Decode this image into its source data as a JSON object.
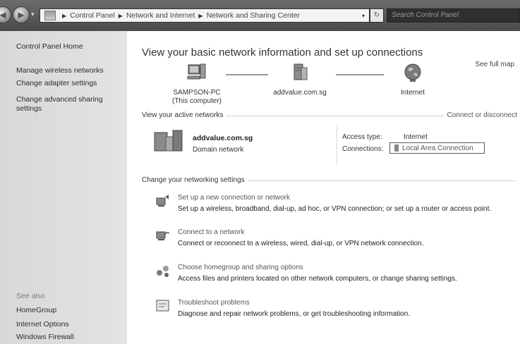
{
  "address_bar": {
    "crumbs": [
      "Control Panel",
      "Network and Internet",
      "Network and Sharing Center"
    ],
    "search_placeholder": "Search Control Panel"
  },
  "left_pane": {
    "home": "Control Panel Home",
    "links": [
      "Manage wireless networks",
      "Change adapter settings",
      "Change advanced sharing settings"
    ],
    "see_also_label": "See also",
    "see_also": [
      "HomeGroup",
      "Internet Options",
      "Windows Firewall"
    ]
  },
  "main": {
    "title": "View your basic network information and set up connections",
    "see_full_map": "See full map",
    "map": {
      "computer_name": "SAMPSON-PC",
      "computer_sub": "(This computer)",
      "domain": "addvalue.com.sg",
      "internet": "Internet"
    },
    "active_networks": {
      "header": "View your active networks",
      "connect_link": "Connect or disconnect",
      "network_name": "addvalue.com.sg",
      "network_type": "Domain network",
      "access_type_label": "Access type:",
      "access_type_value": "Internet",
      "connections_label": "Connections:",
      "connections_value": "Local Area Connection"
    },
    "settings": {
      "header": "Change your networking settings",
      "tasks": [
        {
          "title": "Set up a new connection or network",
          "desc": "Set up a wireless, broadband, dial-up, ad hoc, or VPN connection; or set up a router or access point."
        },
        {
          "title": "Connect to a network",
          "desc": "Connect or reconnect to a wireless, wired, dial-up, or VPN network connection."
        },
        {
          "title": "Choose homegroup and sharing options",
          "desc": "Access files and printers located on other network computers, or change sharing settings."
        },
        {
          "title": "Troubleshoot problems",
          "desc": "Diagnose and repair network problems, or get troubleshooting information."
        }
      ]
    }
  },
  "icons": {
    "back": "back-arrow-icon",
    "forward": "forward-arrow-icon",
    "refresh": "refresh-icon",
    "computer": "computer-icon",
    "server": "server-icon",
    "globe": "globe-icon"
  }
}
